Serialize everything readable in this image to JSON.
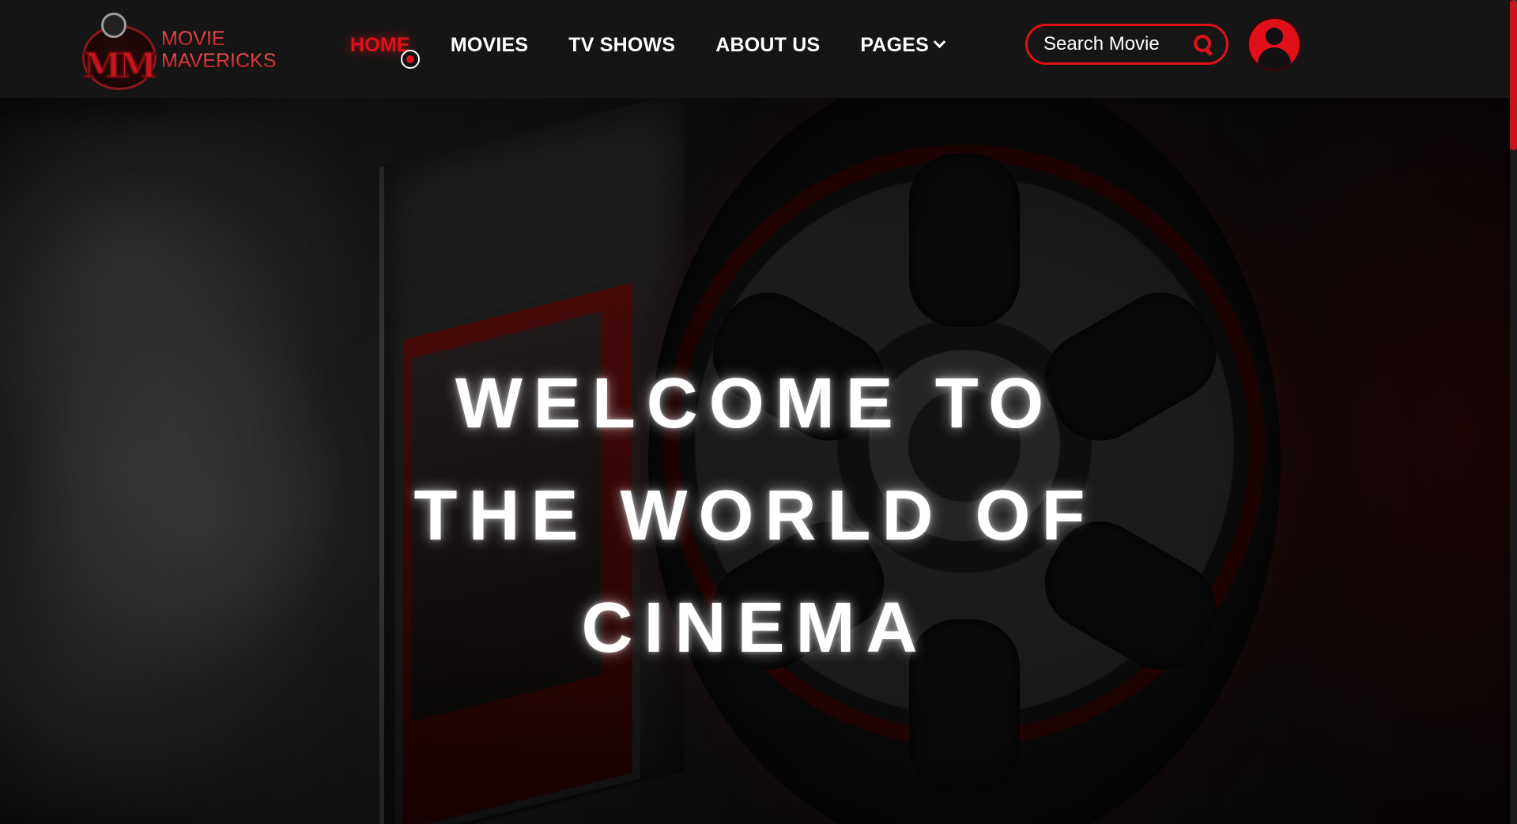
{
  "brand": {
    "line1": "MOVIE",
    "line2": "MAVERICKS",
    "monogram": "MM"
  },
  "nav": {
    "items": [
      {
        "label": "HOME",
        "active": true
      },
      {
        "label": "MOVIES",
        "active": false
      },
      {
        "label": "TV SHOWS",
        "active": false
      },
      {
        "label": "ABOUT US",
        "active": false
      },
      {
        "label": "PAGES",
        "active": false,
        "has_dropdown": true
      }
    ]
  },
  "search": {
    "placeholder": "Search Movie",
    "icon": "search-icon"
  },
  "user": {
    "icon": "user-icon"
  },
  "hero": {
    "title_lines": [
      "WELCOME TO",
      "THE WORLD OF",
      "CINEMA"
    ]
  },
  "colors": {
    "accent": "#e0101a",
    "header_bg": "#161616",
    "text": "#ffffff"
  }
}
